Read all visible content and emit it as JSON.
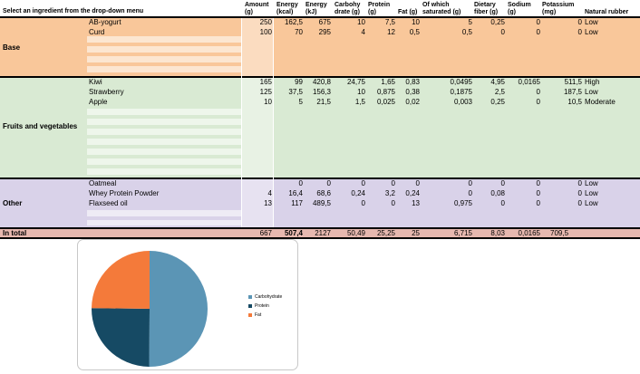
{
  "header": {
    "instruction": "Select an ingredient from the drop-down menu",
    "columns": [
      {
        "key": "amount",
        "label": "Amount (g)"
      },
      {
        "key": "energy_kcal",
        "label": "Energy (kcal)"
      },
      {
        "key": "energy_kj",
        "label": "Energy (kJ)"
      },
      {
        "key": "carbohydrate",
        "label": "Carbohy drate (g)"
      },
      {
        "key": "protein",
        "label": "Protein (g)"
      },
      {
        "key": "fat",
        "label": "Fat (g)"
      },
      {
        "key": "saturated",
        "label": "Of which saturated (g)"
      },
      {
        "key": "fiber",
        "label": "Dietary fiber (g)"
      },
      {
        "key": "sodium",
        "label": "Sodium (g)"
      },
      {
        "key": "potassium",
        "label": "Potassium (mg)"
      },
      {
        "key": "rubber",
        "label": "Natural rubber"
      }
    ]
  },
  "sections": [
    {
      "name": "Base",
      "color": "#f9c79a",
      "rows": [
        {
          "ingredient": "AB-yogurt",
          "amount": "250",
          "energy_kcal": "162,5",
          "energy_kj": "675",
          "carbohydrate": "10",
          "protein": "7,5",
          "fat": "10",
          "saturated": "5",
          "fiber": "0,25",
          "sodium": "0",
          "potassium": "0",
          "rubber": "Low"
        },
        {
          "ingredient": "Curd",
          "amount": "100",
          "energy_kcal": "70",
          "energy_kj": "295",
          "carbohydrate": "4",
          "protein": "12",
          "fat": "0,5",
          "saturated": "0,5",
          "fiber": "0",
          "sodium": "0",
          "potassium": "0",
          "rubber": "Low"
        }
      ]
    },
    {
      "name": "Fruits and vegetables",
      "color": "#d9ead3",
      "rows": [
        {
          "ingredient": "Kiwi",
          "amount": "165",
          "energy_kcal": "99",
          "energy_kj": "420,8",
          "carbohydrate": "24,75",
          "protein": "1,65",
          "fat": "0,83",
          "saturated": "0,0495",
          "fiber": "4,95",
          "sodium": "0,0165",
          "potassium": "511,5",
          "rubber": "High"
        },
        {
          "ingredient": "Strawberry",
          "amount": "125",
          "energy_kcal": "37,5",
          "energy_kj": "156,3",
          "carbohydrate": "10",
          "protein": "0,875",
          "fat": "0,38",
          "saturated": "0,1875",
          "fiber": "2,5",
          "sodium": "0",
          "potassium": "187,5",
          "rubber": "Low"
        },
        {
          "ingredient": "Apple",
          "amount": "10",
          "energy_kcal": "5",
          "energy_kj": "21,5",
          "carbohydrate": "1,5",
          "protein": "0,025",
          "fat": "0,02",
          "saturated": "0,003",
          "fiber": "0,25",
          "sodium": "0",
          "potassium": "10,5",
          "rubber": "Moderate"
        }
      ]
    },
    {
      "name": "Other",
      "color": "#d9d2e9",
      "rows": [
        {
          "ingredient": "Oatmeal",
          "amount": "",
          "energy_kcal": "0",
          "energy_kj": "0",
          "carbohydrate": "0",
          "protein": "0",
          "fat": "0",
          "saturated": "0",
          "fiber": "0",
          "sodium": "0",
          "potassium": "0",
          "rubber": "Low"
        },
        {
          "ingredient": "Whey Protein Powder",
          "amount": "4",
          "energy_kcal": "16,4",
          "energy_kj": "68,6",
          "carbohydrate": "0,24",
          "protein": "3,2",
          "fat": "0,24",
          "saturated": "0",
          "fiber": "0,08",
          "sodium": "0",
          "potassium": "0",
          "rubber": "Low"
        },
        {
          "ingredient": "Flaxseed oil",
          "amount": "13",
          "energy_kcal": "117",
          "energy_kj": "489,5",
          "carbohydrate": "0",
          "protein": "0",
          "fat": "13",
          "saturated": "0,975",
          "fiber": "0",
          "sodium": "0",
          "potassium": "0",
          "rubber": "Low"
        }
      ]
    }
  ],
  "total": {
    "label": "In total",
    "amount": "667",
    "energy_kcal": "507,4",
    "energy_kj": "2127",
    "carbohydrate": "50,49",
    "protein": "25,25",
    "fat": "25",
    "saturated": "6,715",
    "fiber": "8,03",
    "sodium": "0,0165",
    "potassium": "709,5",
    "color": "#e6b8af"
  },
  "chart_data": {
    "type": "pie",
    "categories": [
      "Carbohydrate",
      "Protein",
      "Fat"
    ],
    "values": [
      50.49,
      25.25,
      25
    ],
    "colors": [
      "#5b95b5",
      "#164a64",
      "#f47a3a"
    ],
    "legend_position": "right",
    "title": ""
  }
}
